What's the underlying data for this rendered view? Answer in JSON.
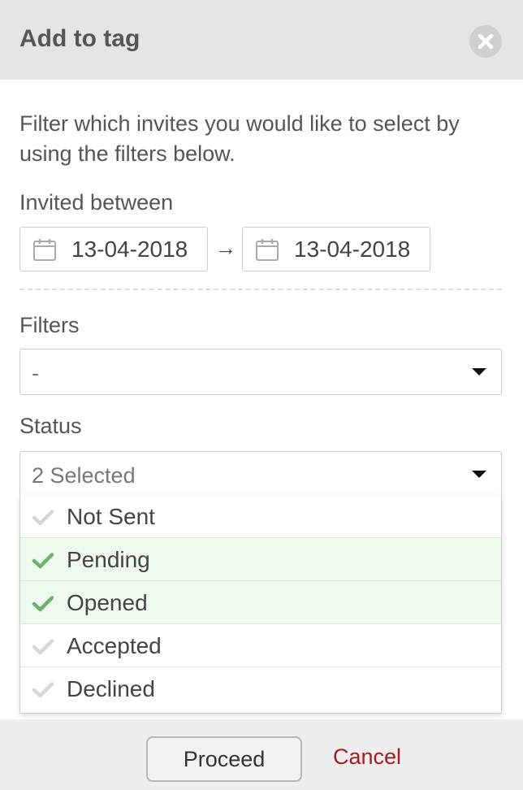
{
  "dialog": {
    "title": "Add to tag",
    "close_icon": "close-circle-icon",
    "intro": "Filter which invites you would like to select by using the filters below."
  },
  "invited_between": {
    "label": "Invited between",
    "from": "13-04-2018",
    "to": "13-04-2018",
    "separator": "→",
    "icon": "calendar-icon"
  },
  "filters": {
    "label": "Filters",
    "value": "-"
  },
  "status": {
    "label": "Status",
    "value": "2 Selected",
    "options": [
      {
        "label": "Not Sent",
        "selected": false
      },
      {
        "label": "Pending",
        "selected": true
      },
      {
        "label": "Opened",
        "selected": true
      },
      {
        "label": "Accepted",
        "selected": false
      },
      {
        "label": "Declined",
        "selected": false
      }
    ]
  },
  "footer": {
    "proceed": "Proceed",
    "cancel": "Cancel"
  },
  "colors": {
    "header_bg": "#e5e5e5",
    "selected_bg": "#eefaee",
    "check_on": "#6cb36c",
    "check_off": "#d6d6d6",
    "cancel": "#a31e1e"
  }
}
